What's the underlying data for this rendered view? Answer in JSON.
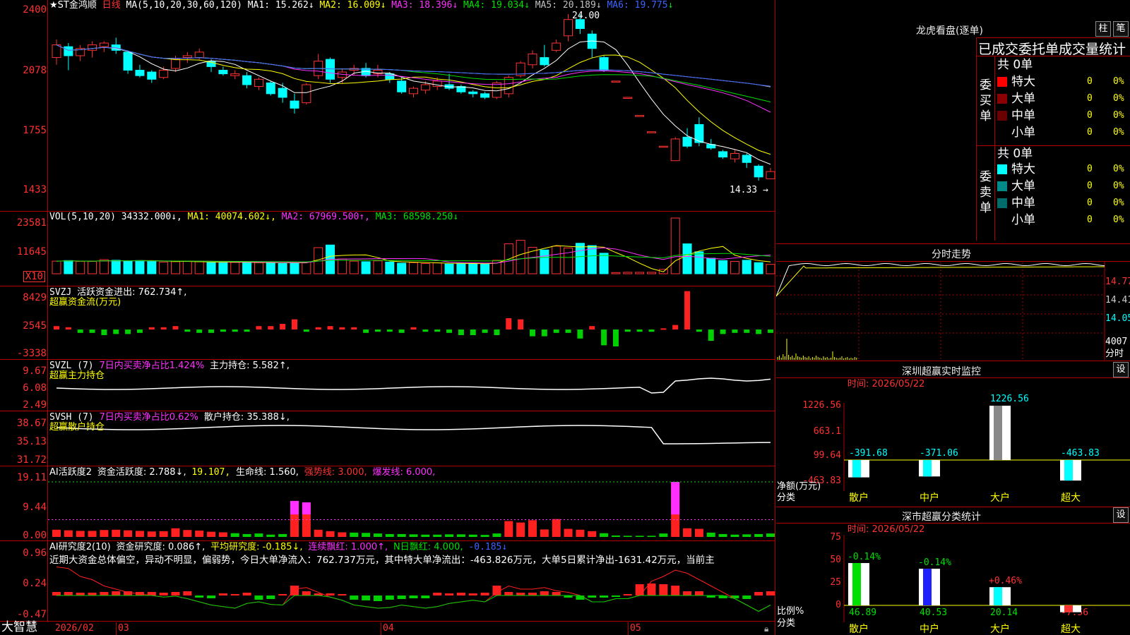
{
  "main_chart": {
    "stock_name": "★ST金鸿顺",
    "period": "日线",
    "ma_label": "MA(5,10,20,30,60,120)",
    "ma": [
      {
        "label": "MA1: 15.262↓",
        "color": "#ffffff"
      },
      {
        "label": "MA2: 16.009↓",
        "color": "#ffff00"
      },
      {
        "label": "MA3: 18.396↓",
        "color": "#ff30ff"
      },
      {
        "label": "MA4: 19.034↓",
        "color": "#00e000"
      },
      {
        "label": "MA5: 20.189↓",
        "color": "#c0c0c0"
      },
      {
        "label": "MA6: 19.775",
        "color": "#3c64ff"
      }
    ],
    "ma6_arrow": "↓",
    "y_ticks": [
      "2400",
      "2078",
      "1755",
      "1433"
    ],
    "high_marker": "24.00",
    "low_marker": "14.33 →",
    "candles": [
      {
        "o": 21.6,
        "c": 22.3,
        "h": 22.6,
        "l": 21.2
      },
      {
        "o": 22.2,
        "c": 21.7,
        "h": 22.4,
        "l": 20.9
      },
      {
        "o": 21.7,
        "c": 22.1,
        "h": 22.3,
        "l": 21.4
      },
      {
        "o": 22.0,
        "c": 22.3,
        "h": 22.5,
        "l": 21.6
      },
      {
        "o": 22.2,
        "c": 22.4,
        "h": 22.5,
        "l": 21.9
      },
      {
        "o": 22.3,
        "c": 22.0,
        "h": 22.7,
        "l": 21.8
      },
      {
        "o": 21.9,
        "c": 20.9,
        "h": 22.0,
        "l": 20.7
      },
      {
        "o": 20.9,
        "c": 20.6,
        "h": 21.2,
        "l": 20.5
      },
      {
        "o": 20.8,
        "c": 20.4,
        "h": 20.9,
        "l": 20.2
      },
      {
        "o": 20.5,
        "c": 20.9,
        "h": 21.1,
        "l": 20.4
      },
      {
        "o": 21.0,
        "c": 21.5,
        "h": 21.7,
        "l": 20.8
      },
      {
        "o": 21.6,
        "c": 21.7,
        "h": 21.9,
        "l": 21.3
      },
      {
        "o": 21.6,
        "c": 21.9,
        "h": 22.1,
        "l": 21.5
      },
      {
        "o": 21.4,
        "c": 21.1,
        "h": 21.5,
        "l": 20.8
      },
      {
        "o": 20.9,
        "c": 20.7,
        "h": 21.1,
        "l": 20.6
      },
      {
        "o": 20.6,
        "c": 20.7,
        "h": 20.9,
        "l": 20.4
      },
      {
        "o": 20.6,
        "c": 20.1,
        "h": 20.8,
        "l": 19.9
      },
      {
        "o": 20.0,
        "c": 20.4,
        "h": 20.5,
        "l": 19.8
      },
      {
        "o": 20.2,
        "c": 19.6,
        "h": 20.3,
        "l": 19.5
      },
      {
        "o": 19.9,
        "c": 19.4,
        "h": 20.2,
        "l": 19.1
      },
      {
        "o": 19.2,
        "c": 18.8,
        "h": 19.6,
        "l": 18.5
      },
      {
        "o": 19.1,
        "c": 20.1,
        "h": 20.2,
        "l": 19.0
      },
      {
        "o": 20.6,
        "c": 21.4,
        "h": 21.8,
        "l": 20.4
      },
      {
        "o": 21.5,
        "c": 20.4,
        "h": 21.6,
        "l": 20.2
      },
      {
        "o": 20.5,
        "c": 20.8,
        "h": 21.0,
        "l": 20.2
      },
      {
        "o": 20.9,
        "c": 21.0,
        "h": 21.2,
        "l": 20.6
      },
      {
        "o": 21.0,
        "c": 20.6,
        "h": 21.3,
        "l": 20.5
      },
      {
        "o": 20.7,
        "c": 20.9,
        "h": 21.2,
        "l": 20.5
      },
      {
        "o": 20.7,
        "c": 20.4,
        "h": 20.8,
        "l": 20.2
      },
      {
        "o": 20.3,
        "c": 19.7,
        "h": 20.5,
        "l": 19.6
      },
      {
        "o": 19.6,
        "c": 19.9,
        "h": 20.0,
        "l": 19.4
      },
      {
        "o": 19.8,
        "c": 20.1,
        "h": 20.3,
        "l": 19.6
      },
      {
        "o": 20.0,
        "c": 20.3,
        "h": 20.5,
        "l": 19.8
      },
      {
        "o": 20.1,
        "c": 19.9,
        "h": 20.7,
        "l": 19.8
      },
      {
        "o": 20.0,
        "c": 19.7,
        "h": 20.1,
        "l": 19.6
      },
      {
        "o": 19.7,
        "c": 19.6,
        "h": 19.8,
        "l": 19.4
      },
      {
        "o": 19.6,
        "c": 19.4,
        "h": 19.7,
        "l": 19.3
      },
      {
        "o": 19.4,
        "c": 20.2,
        "h": 20.3,
        "l": 19.3
      },
      {
        "o": 19.6,
        "c": 20.5,
        "h": 20.6,
        "l": 19.4
      },
      {
        "o": 20.6,
        "c": 21.3,
        "h": 21.4,
        "l": 20.5
      },
      {
        "o": 21.2,
        "c": 21.8,
        "h": 22.0,
        "l": 21.0
      },
      {
        "o": 21.6,
        "c": 21.2,
        "h": 22.3,
        "l": 21.1
      },
      {
        "o": 22.0,
        "c": 22.4,
        "h": 22.6,
        "l": 21.9
      },
      {
        "o": 22.8,
        "c": 23.7,
        "h": 24.0,
        "l": 22.5
      },
      {
        "o": 23.7,
        "c": 23.2,
        "h": 24.0,
        "l": 22.9
      },
      {
        "o": 22.9,
        "c": 22.1,
        "h": 23.1,
        "l": 21.6
      },
      {
        "o": 21.6,
        "c": 20.9,
        "h": 21.7,
        "l": 20.8
      },
      {
        "o": 20.3,
        "c": 20.3,
        "h": 20.3,
        "l": 20.3
      },
      {
        "o": 19.4,
        "c": 19.4,
        "h": 19.4,
        "l": 19.4
      },
      {
        "o": 18.4,
        "c": 18.4,
        "h": 18.4,
        "l": 18.4
      },
      {
        "o": 17.5,
        "c": 17.5,
        "h": 17.5,
        "l": 17.5
      },
      {
        "o": 16.7,
        "c": 16.7,
        "h": 16.7,
        "l": 16.7
      },
      {
        "o": 15.9,
        "c": 17.1,
        "h": 17.2,
        "l": 15.9
      },
      {
        "o": 17.2,
        "c": 16.7,
        "h": 17.7,
        "l": 16.6
      },
      {
        "o": 17.9,
        "c": 16.9,
        "h": 18.3,
        "l": 16.7
      },
      {
        "o": 16.8,
        "c": 16.6,
        "h": 17.1,
        "l": 16.5
      },
      {
        "o": 16.4,
        "c": 16.1,
        "h": 16.5,
        "l": 16.0
      },
      {
        "o": 16.0,
        "c": 16.3,
        "h": 16.5,
        "l": 15.8
      },
      {
        "o": 16.2,
        "c": 15.8,
        "h": 16.3,
        "l": 15.5
      },
      {
        "o": 15.6,
        "c": 15.0,
        "h": 15.7,
        "l": 14.8
      },
      {
        "o": 14.9,
        "c": 15.3,
        "h": 15.5,
        "l": 14.9
      }
    ]
  },
  "vol_panel": {
    "label": "VOL(5,10,20)",
    "value": "34332.000↓,",
    "ma1": "MA1: 40074.602↓,",
    "ma2": "MA2: 67969.500↑,",
    "ma3": "MA3: 68598.250↓",
    "y_ticks": [
      "23581",
      "11645"
    ],
    "unit": "X10"
  },
  "svzj_panel": {
    "label": "SVZJ",
    "text": "活跃资金进出: 762.734↑,",
    "subtitle": "超赢资金流(万元)",
    "y_ticks": [
      "8429",
      "2545",
      "-3338"
    ]
  },
  "svzl_panel": {
    "label": "SVZL (7)",
    "net": "7日内买卖净占比1.424%",
    "hold": "主力持仓: 5.582↑,",
    "subtitle": "超赢主力持仓",
    "y_ticks": [
      "9.67",
      "6.08",
      "2.49"
    ]
  },
  "svsh_panel": {
    "label": "SVSH (7)",
    "net": "7日内买卖净占比0.62%",
    "hold": "散户持仓: 35.388↓,",
    "subtitle": "超赢散户持仓",
    "y_ticks": [
      "38.67",
      "35.13",
      "31.72"
    ]
  },
  "ai_active_panel": {
    "label": "AI活跃度2",
    "fund": "资金活跃度: 2.788↓,",
    "v2": "19.107,",
    "life": "生命线: 1.560,",
    "strong": "强势线: 3.000,",
    "burst": "爆发线: 6.000,",
    "y_ticks": [
      "19.11",
      "9.44",
      "0.00"
    ]
  },
  "ai_research_panel": {
    "label": "AI研究度2(10)",
    "research": "资金研究度: 0.086↑,",
    "avg": "平均研究度: -0.185↓,",
    "consec": "连续飘红: 1.000↑,",
    "nday": "N日飘红: 4.000,",
    "last": "-0.185↓",
    "summary": "近期大资金总体偏空，异动不明显，偏弱势，今日大单净流入：762.737万元，其中特大单净流出：-463.826万元，大单5日累计净出-1631.42万元，当前主",
    "y_ticks": [
      "0.96",
      "0.24",
      "-0.47"
    ]
  },
  "bottom_bar": {
    "brand": "大智慧",
    "dates": [
      "2026/02",
      "03",
      "04",
      "05"
    ]
  },
  "right_panel": {
    "dragon_title": "龙虎看盘(逐单)",
    "btn_zhu": "柱",
    "btn_bi": "笔",
    "stats_title": "已成交委托单成交量统计",
    "buy_side": {
      "label": "委买单",
      "total": "共 0单",
      "rows": [
        {
          "name": "特大",
          "count": "0",
          "pct": "0%",
          "color": "#ff0000"
        },
        {
          "name": "大单",
          "count": "0",
          "pct": "0%",
          "color": "#8b0000"
        },
        {
          "name": "中单",
          "count": "0",
          "pct": "0%",
          "color": "#6b0000"
        },
        {
          "name": "小单",
          "count": "0",
          "pct": "0%",
          "color": "#000000"
        }
      ]
    },
    "sell_side": {
      "label": "委卖单",
      "total": "共 0单",
      "rows": [
        {
          "name": "特大",
          "count": "0",
          "pct": "0%",
          "color": "#00ffff"
        },
        {
          "name": "大单",
          "count": "0",
          "pct": "0%",
          "color": "#008b8b"
        },
        {
          "name": "中单",
          "count": "0",
          "pct": "0%",
          "color": "#006b6b"
        },
        {
          "name": "小单",
          "count": "0",
          "pct": "0%",
          "color": "#000000"
        }
      ]
    },
    "intraday": {
      "title": "分时走势",
      "price_ticks": [
        "14.77",
        "14.41",
        "14.05"
      ],
      "vol_tick": "4007",
      "vol_unit": "分时"
    },
    "sz_monitor": {
      "title": "深圳超赢实时监控",
      "btn": "设",
      "time": "时间: 2026/05/22",
      "y_ticks": [
        "1226.56",
        "663.1",
        "99.64",
        "-463.83"
      ],
      "y_label": "净额(万元)",
      "x_label": "分类",
      "categories": [
        "散户",
        "中户",
        "大户",
        "超大"
      ],
      "values": [
        -391.68,
        -371.06,
        1226.56,
        -463.83
      ],
      "value_labels": [
        "-391.68",
        "-371.06",
        "1226.56",
        "-463.83"
      ]
    },
    "sz_class": {
      "title": "深市超赢分类统计",
      "btn": "设",
      "time": "时间: 2026/05/22",
      "y_ticks": [
        "75",
        "50",
        "25",
        "0"
      ],
      "y_label": "比例%",
      "x_label": "分类",
      "categories": [
        "散户",
        "中户",
        "大户",
        "超大"
      ],
      "values": [
        46.89,
        40.53,
        20.14,
        -7.56
      ],
      "value_labels": [
        "46.89",
        "40.53",
        "20.14",
        "-7.56"
      ],
      "change_labels": [
        "-0.14%",
        "-0.14%",
        "+0.46%",
        ""
      ]
    }
  }
}
